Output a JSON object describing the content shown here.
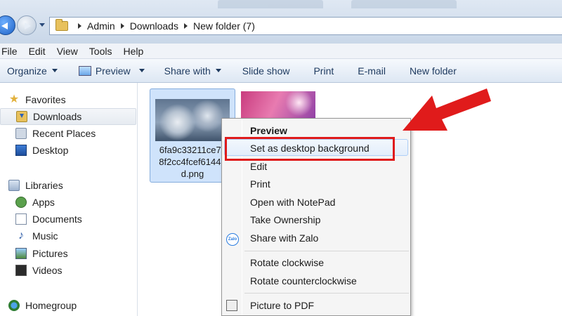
{
  "address": {
    "crumbs": [
      "Admin",
      "Downloads",
      "New folder (7)"
    ]
  },
  "menubar": [
    "File",
    "Edit",
    "View",
    "Tools",
    "Help"
  ],
  "toolbar": {
    "organize": "Organize",
    "preview": "Preview",
    "share_with": "Share with",
    "slide_show": "Slide show",
    "print": "Print",
    "email": "E-mail",
    "new_folder": "New folder"
  },
  "navpane": {
    "favorites": "Favorites",
    "downloads": "Downloads",
    "recent_places": "Recent Places",
    "desktop": "Desktop",
    "libraries": "Libraries",
    "apps": "Apps",
    "documents": "Documents",
    "music": "Music",
    "pictures": "Pictures",
    "videos": "Videos",
    "homegroup": "Homegroup"
  },
  "files": [
    {
      "name_line1": "6fa9c33211ce7c",
      "name_line2": "8f2cc4fcef6144b",
      "name_line3": "d.png"
    }
  ],
  "context_menu": {
    "preview": "Preview",
    "set_desktop_bg": "Set as desktop background",
    "edit": "Edit",
    "print": "Print",
    "open_notepad": "Open with NotePad",
    "take_ownership": "Take Ownership",
    "share_zalo": "Share with Zalo",
    "rotate_cw": "Rotate clockwise",
    "rotate_ccw": "Rotate counterclockwise",
    "picture_pdf": "Picture to PDF",
    "zalo_icon_text": "Zalo"
  },
  "colors": {
    "annotation_red": "#e01b1b",
    "selection_blue": "#cfe3fb"
  }
}
